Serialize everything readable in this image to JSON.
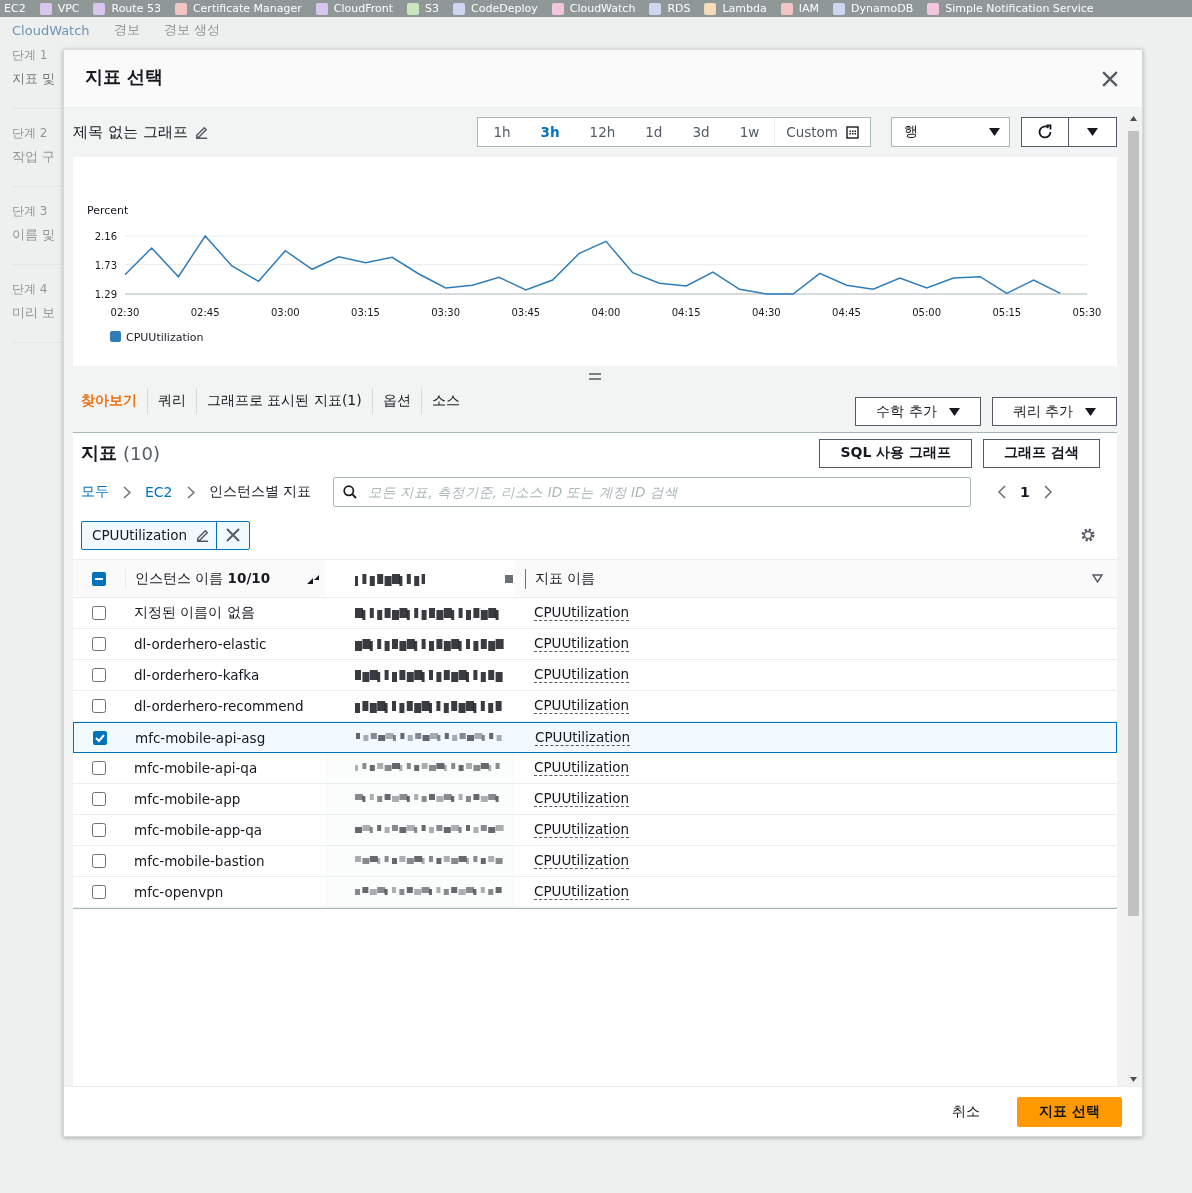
{
  "top_nav": {
    "items": [
      {
        "label": "EC2"
      },
      {
        "label": "VPC",
        "color": "#d9c6ef"
      },
      {
        "label": "Route 53",
        "color": "#d9c6ef"
      },
      {
        "label": "Certificate Manager",
        "color": "#f2c4c4"
      },
      {
        "label": "CloudFront",
        "color": "#d9c6ef"
      },
      {
        "label": "S3",
        "color": "#c8e6c0"
      },
      {
        "label": "CodeDeploy",
        "color": "#cdd6f2"
      },
      {
        "label": "CloudWatch",
        "color": "#f2c6dc"
      },
      {
        "label": "RDS",
        "color": "#cdd6f2"
      },
      {
        "label": "Lambda",
        "color": "#f6dcb8"
      },
      {
        "label": "IAM",
        "color": "#f2c4c4"
      },
      {
        "label": "DynamoDB",
        "color": "#cdd6f2"
      },
      {
        "label": "Simple Notification Service",
        "color": "#f2c6dc"
      }
    ]
  },
  "background": {
    "breadcrumb": [
      "CloudWatch",
      "경보",
      "경보 생성"
    ],
    "steps": [
      {
        "step": "단계 1",
        "title": "지표 및"
      },
      {
        "step": "단계 2",
        "title": "작업 구"
      },
      {
        "step": "단계 3",
        "title": "이름 및"
      },
      {
        "step": "단계 4",
        "title": "미리 보"
      }
    ]
  },
  "modal": {
    "title": "지표 선택",
    "graph_title": "제목 없는 그래프",
    "time_ranges": [
      {
        "label": "1h",
        "selected": false,
        "kind": "preset"
      },
      {
        "label": "3h",
        "selected": true,
        "kind": "preset"
      },
      {
        "label": "12h",
        "selected": false,
        "kind": "preset"
      },
      {
        "label": "1d",
        "selected": false,
        "kind": "preset"
      },
      {
        "label": "3d",
        "selected": false,
        "kind": "preset"
      },
      {
        "label": "1w",
        "selected": false,
        "kind": "preset"
      },
      {
        "label": "Custom",
        "selected": false,
        "kind": "custom"
      }
    ],
    "view_select": {
      "value": "행"
    },
    "chart": {
      "chart_data": {
        "type": "line",
        "ylabel": "Percent",
        "categories": [
          "02:30",
          null,
          null,
          "02:45",
          null,
          null,
          "03:00",
          null,
          null,
          "03:15",
          null,
          null,
          "03:30",
          null,
          null,
          "03:45",
          null,
          null,
          "04:00",
          null,
          null,
          "04:15",
          null,
          null,
          "04:30",
          null,
          null,
          "04:45",
          null,
          null,
          "05:00",
          null,
          null,
          "05:15",
          null,
          null,
          "05:30"
        ],
        "series": [
          {
            "name": "CPUUtilization",
            "color": "#2e7cb8",
            "values": [
              1.58,
              1.98,
              1.55,
              2.16,
              1.71,
              1.48,
              1.94,
              1.66,
              1.85,
              1.76,
              1.84,
              1.59,
              1.38,
              1.42,
              1.54,
              1.35,
              1.5,
              1.9,
              2.08,
              1.61,
              1.45,
              1.41,
              1.62,
              1.36,
              1.29,
              1.29,
              1.6,
              1.42,
              1.36,
              1.53,
              1.38,
              1.53,
              1.55,
              1.3,
              1.5,
              1.3,
              null
            ]
          }
        ],
        "ylim": [
          1.29,
          2.16
        ],
        "yticks": [
          1.29,
          1.73,
          2.16
        ]
      }
    },
    "tabs": [
      {
        "label": "찾아보기",
        "selected": true
      },
      {
        "label": "쿼리",
        "selected": false
      },
      {
        "label": "그래프로 표시된 지표(1)",
        "selected": false
      },
      {
        "label": "옵션",
        "selected": false
      },
      {
        "label": "소스",
        "selected": false
      }
    ],
    "tab_actions": [
      "수학 추가",
      "쿼리 추가"
    ],
    "metrics": {
      "title": "지표",
      "count": "(10)",
      "actions": [
        "SQL 사용 그래프",
        "그래프 검색"
      ],
      "breadcrumb": [
        {
          "label": "모두",
          "link": true
        },
        {
          "label": "EC2",
          "link": true
        },
        {
          "label": "인스턴스별 지표",
          "link": false
        }
      ],
      "search": {
        "placeholder": "모든 지표, 측정기준, 리소스 ID 또는 계정 ID 검색"
      },
      "page": "1",
      "filter_token": "CPUUtilization",
      "table": {
        "select_all": {
          "partial": true
        },
        "columns": [
          "인스턴스 이름 **10/10**",
          "지표 이름"
        ],
        "rows": [
          {
            "instance_name": "지정된 이름이 없음",
            "metric_name": "CPUUtilization",
            "checked": false
          },
          {
            "instance_name": "dl-orderhero-elastic",
            "metric_name": "CPUUtilization",
            "checked": false
          },
          {
            "instance_name": "dl-orderhero-kafka",
            "metric_name": "CPUUtilization",
            "checked": false
          },
          {
            "instance_name": "dl-orderhero-recommend",
            "metric_name": "CPUUtilization",
            "checked": false
          },
          {
            "instance_name": "mfc-mobile-api-asg",
            "metric_name": "CPUUtilization",
            "checked": true
          },
          {
            "instance_name": "mfc-mobile-api-qa",
            "metric_name": "CPUUtilization",
            "checked": false
          },
          {
            "instance_name": "mfc-mobile-app",
            "metric_name": "CPUUtilization",
            "checked": false
          },
          {
            "instance_name": "mfc-mobile-app-qa",
            "metric_name": "CPUUtilization",
            "checked": false
          },
          {
            "instance_name": "mfc-mobile-bastion",
            "metric_name": "CPUUtilization",
            "checked": false
          },
          {
            "instance_name": "mfc-openvpn",
            "metric_name": "CPUUtilization",
            "checked": false
          }
        ]
      }
    },
    "footer": {
      "cancel": "취소",
      "confirm": "지표 선택"
    }
  }
}
